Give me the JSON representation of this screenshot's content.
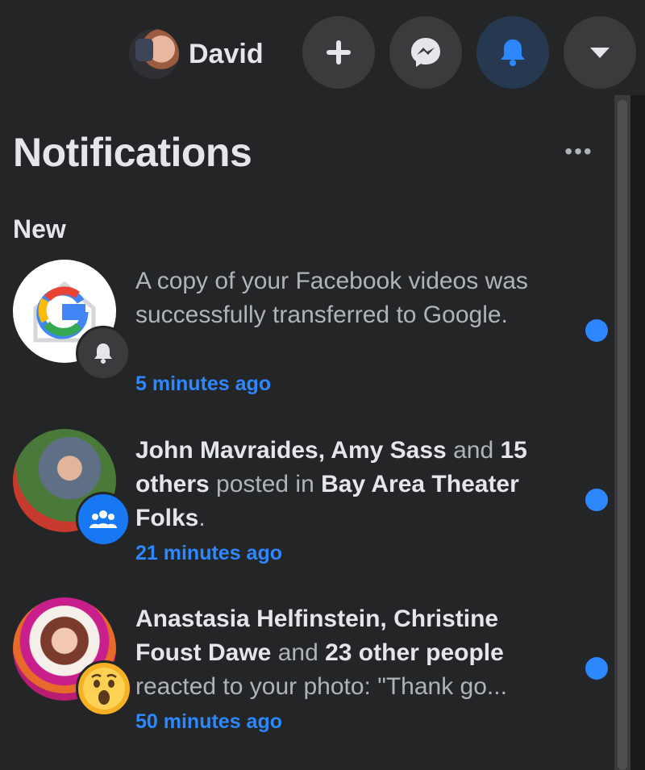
{
  "header": {
    "profile_name": "David",
    "buttons": {
      "create": "plus-icon",
      "messenger": "messenger-icon",
      "notifications": "bell-icon",
      "account_menu": "caret-down-icon"
    }
  },
  "panel": {
    "title": "Notifications",
    "more_label": "•••",
    "section_label": "New"
  },
  "notifications": [
    {
      "text": "A copy of your Facebook videos was successfully transferred to Google.",
      "time": "5 minutes ago",
      "badge": "bell-icon",
      "unread": true
    },
    {
      "bold_1": "John Mavraides, Amy Sass",
      "plain_1": " and ",
      "bold_2": "15 others",
      "plain_2": " posted in ",
      "bold_3": "Bay Area Theater Folks",
      "plain_3": ".",
      "time": "21 minutes ago",
      "badge": "group-icon",
      "unread": true
    },
    {
      "bold_1": "Anastasia Helfinstein, Christine Foust Dawe",
      "plain_1": " and ",
      "bold_2": "23 other people",
      "plain_2": " reacted to your photo: \"Thank go...",
      "time": "50 minutes ago",
      "badge": "wow-reaction-icon",
      "unread": true
    }
  ],
  "colors": {
    "accent": "#2d88ff",
    "background": "#18191a",
    "surface": "#242526"
  }
}
